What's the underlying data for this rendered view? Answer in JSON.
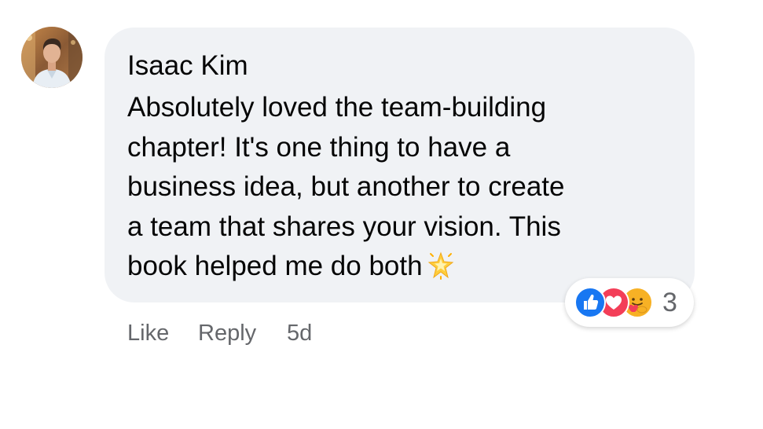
{
  "comment": {
    "author": "Isaac Kim",
    "text_lines": [
      "Absolutely loved the team-building",
      "chapter! It's one thing to have a",
      "business idea, but another to create",
      "a team that shares your vision. This",
      "book helped me do both"
    ],
    "emoji_icon": "glowing-star-icon",
    "reactions": {
      "icons": [
        "like-icon",
        "love-icon",
        "care-icon"
      ],
      "count": "3"
    },
    "actions": {
      "like_label": "Like",
      "reply_label": "Reply",
      "timestamp": "5d"
    }
  },
  "colors": {
    "bubble_bg": "#f0f2f5",
    "text": "#050505",
    "secondary_text": "#65676b",
    "like_blue": "#1877f2",
    "love_red": "#f33e58",
    "care_yellow": "#f7b125"
  }
}
